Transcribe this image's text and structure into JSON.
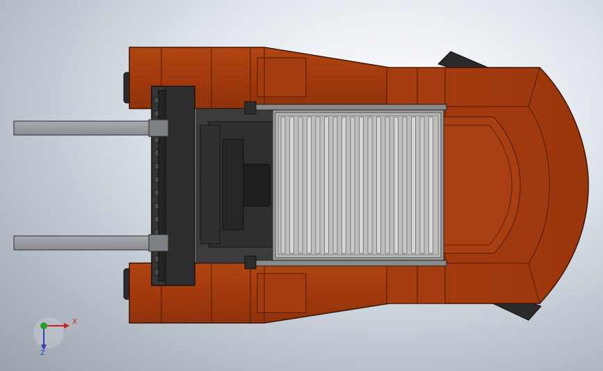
{
  "viewport": {
    "background_top": "#eef2f6",
    "background_bottom": "#9aa2ad"
  },
  "model": {
    "body_color": "#a83d0f",
    "body_edge_color": "#4a1a05",
    "chassis_color": "#3a3a3a",
    "fork_color": "#9a9da1",
    "radiator_color": "#bfbfbf"
  },
  "triad": {
    "x_label": "X",
    "z_label": "Z",
    "x_color": "#cc1f1f",
    "y_color": "#23a323",
    "z_color": "#2f3fb8"
  }
}
